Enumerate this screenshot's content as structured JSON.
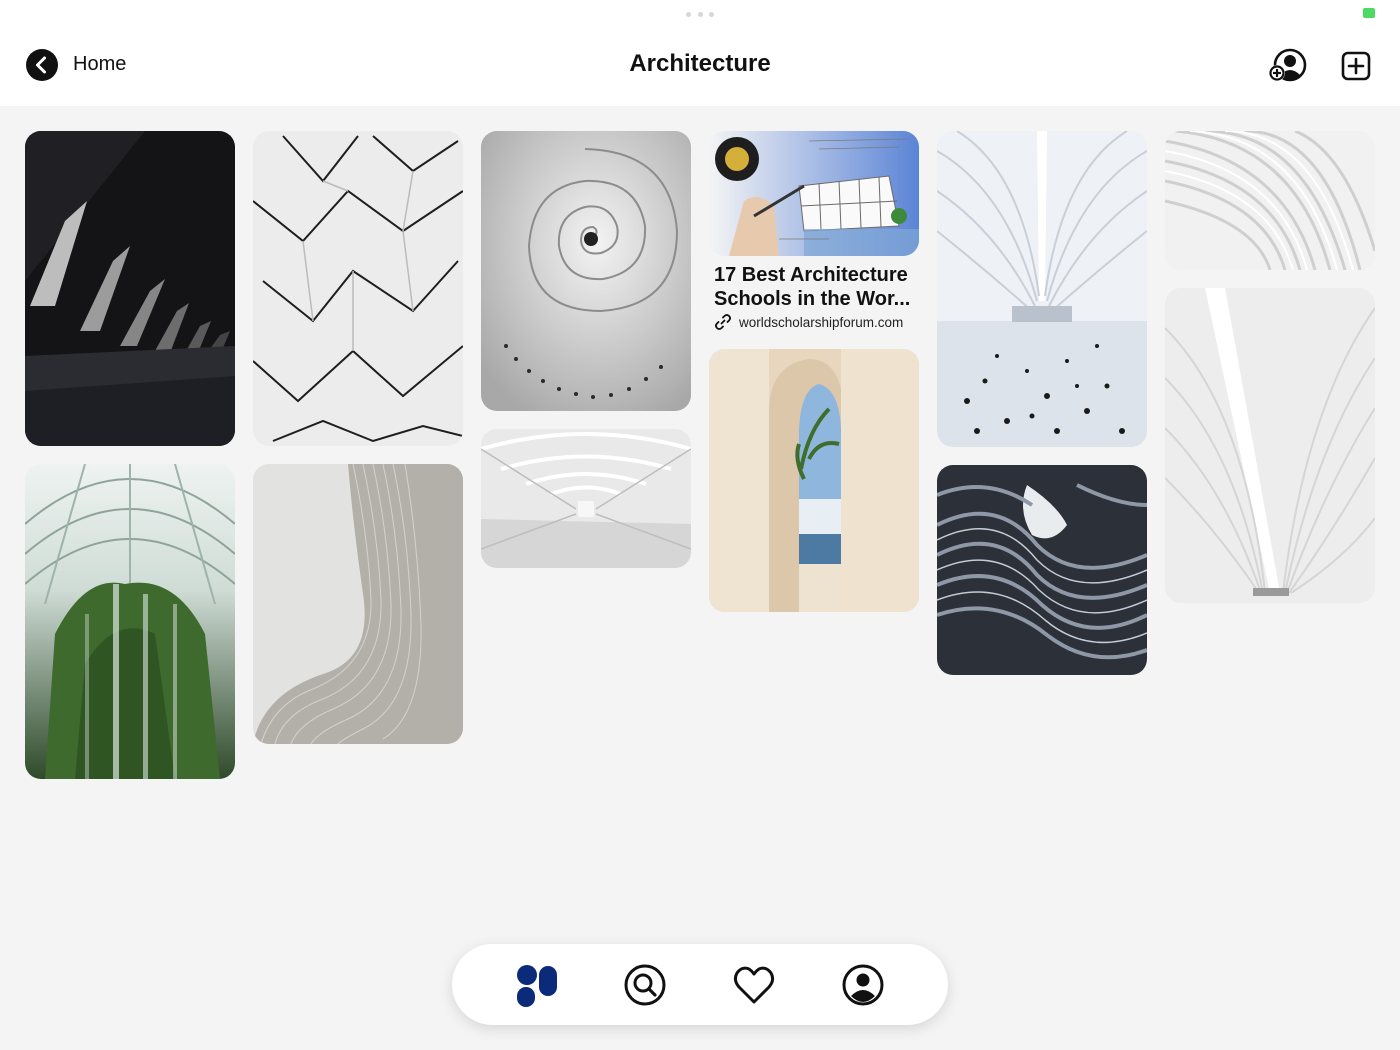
{
  "header": {
    "back_label": "Home",
    "title": "Architecture"
  },
  "pin_with_link": {
    "title_line1": "17 Best Architecture",
    "title_line2": "Schools in the Wor...",
    "link": "worldscholarshipforum.com"
  },
  "colors": {
    "accent": "#0b2a7a",
    "background": "#f4f4f4"
  },
  "tabs": [
    {
      "name": "home",
      "icon": "pins-icon",
      "active": true
    },
    {
      "name": "search",
      "icon": "search-icon"
    },
    {
      "name": "favorites",
      "icon": "heart-icon"
    },
    {
      "name": "profile",
      "icon": "profile-icon"
    }
  ]
}
